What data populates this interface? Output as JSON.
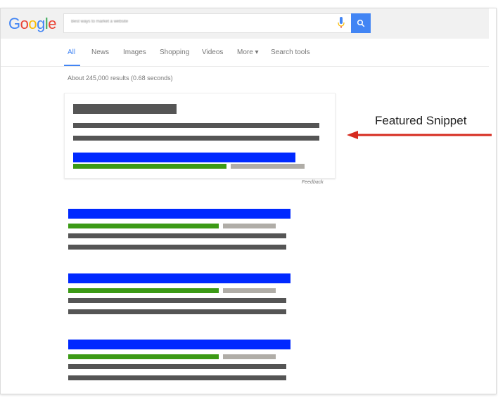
{
  "header": {
    "logo_letters": [
      {
        "char": "G",
        "color": "#4285f4"
      },
      {
        "char": "o",
        "color": "#ea4335"
      },
      {
        "char": "o",
        "color": "#fbbc05"
      },
      {
        "char": "g",
        "color": "#4285f4"
      },
      {
        "char": "l",
        "color": "#34a853"
      },
      {
        "char": "e",
        "color": "#ea4335"
      }
    ],
    "search_query": "Best ways to market a website",
    "search_button_icon": "search-icon",
    "mic_icon": "microphone-icon",
    "accent_color": "#4285f4"
  },
  "tabs": [
    {
      "label": "All",
      "active": true
    },
    {
      "label": "News",
      "active": false
    },
    {
      "label": "Images",
      "active": false
    },
    {
      "label": "Shopping",
      "active": false
    },
    {
      "label": "Videos",
      "active": false
    },
    {
      "label": "More ▾",
      "active": false
    },
    {
      "label": "Search tools",
      "active": false
    }
  ],
  "result_stats": "About 245,000 results (0.68 seconds)",
  "featured_snippet": {
    "feedback_label": "Feedback"
  },
  "annotation": {
    "label": "Featured Snippet",
    "arrow_color": "#d62b1f"
  },
  "colors": {
    "title_link": "#0029ff",
    "url": "#3c9a16",
    "url_meta": "#b0ada7",
    "text": "#555555"
  },
  "organic_results_count": 3
}
